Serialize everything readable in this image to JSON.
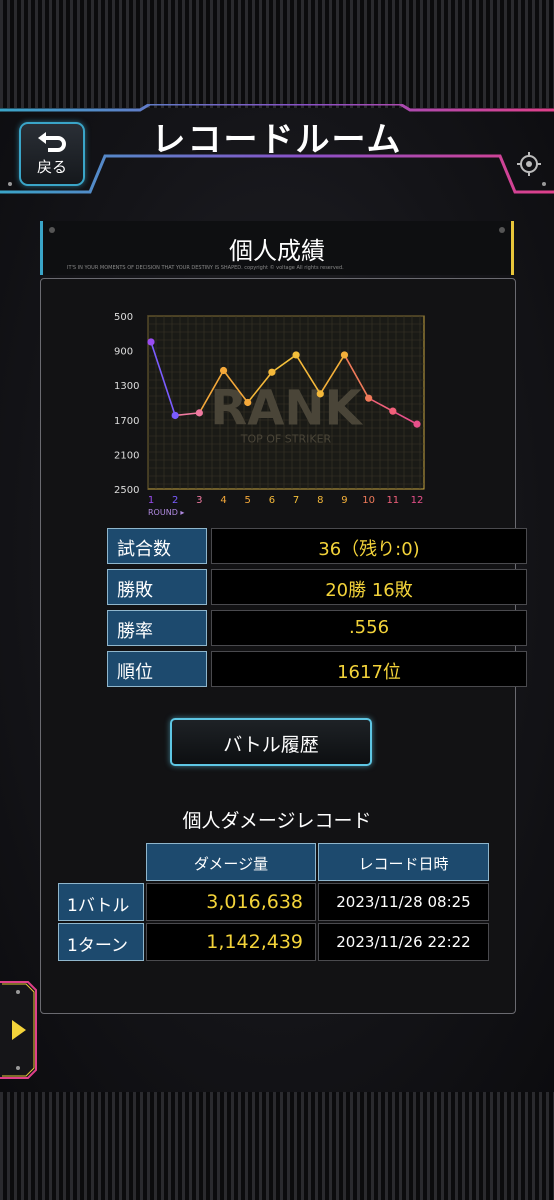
{
  "header": {
    "title": "レコードルーム",
    "back_label": "戻る"
  },
  "section": {
    "title": "個人成績",
    "fine_print": "IT'S IN YOUR MOMENTS OF DECISION THAT YOUR DESTINY IS SHAPED. copyright © voltage All rights reserved."
  },
  "chart_data": {
    "type": "line",
    "x": [
      1,
      2,
      3,
      4,
      5,
      6,
      7,
      8,
      9,
      10,
      11,
      12
    ],
    "values": [
      800,
      1650,
      1620,
      1130,
      1500,
      1150,
      950,
      1400,
      950,
      1450,
      1600,
      1750
    ],
    "yticks": [
      "500",
      "900",
      "1300",
      "1700",
      "2100",
      "2500"
    ],
    "ylim": [
      500,
      2500
    ],
    "y_inverted": true,
    "xlabel": "ROUND ▸",
    "grid": true,
    "watermark": "RANK",
    "watermark_sub": "TOP OF STRIKER",
    "point_colors": [
      "#9a4cf0",
      "#7a5cff",
      "#f07aa0",
      "#f4a83a",
      "#f4a83a",
      "#f4b83a",
      "#f4c03a",
      "#f4b83a",
      "#f4b03a",
      "#f07a5a",
      "#f0607a",
      "#e8508a"
    ]
  },
  "stats": [
    {
      "label": "試合数",
      "value": "36（残り:0)"
    },
    {
      "label": "勝敗",
      "value": "20勝 16敗"
    },
    {
      "label": "勝率",
      "value": ".556"
    },
    {
      "label": "順位",
      "value": "1617位"
    }
  ],
  "battle_history_label": "バトル履歴",
  "damage": {
    "title": "個人ダメージレコード",
    "col_amount": "ダメージ量",
    "col_date": "レコード日時",
    "rows": [
      {
        "label": "1バトル",
        "amount": "3,016,638",
        "date": "2023/11/28 08:25"
      },
      {
        "label": "1ターン",
        "amount": "1,142,439",
        "date": "2023/11/26 22:22"
      }
    ]
  },
  "colors": {
    "accent_blue": "#3aa5c8",
    "accent_pink": "#e0408a",
    "accent_yellow": "#e8c63a",
    "value_text": "#f3d33a"
  }
}
